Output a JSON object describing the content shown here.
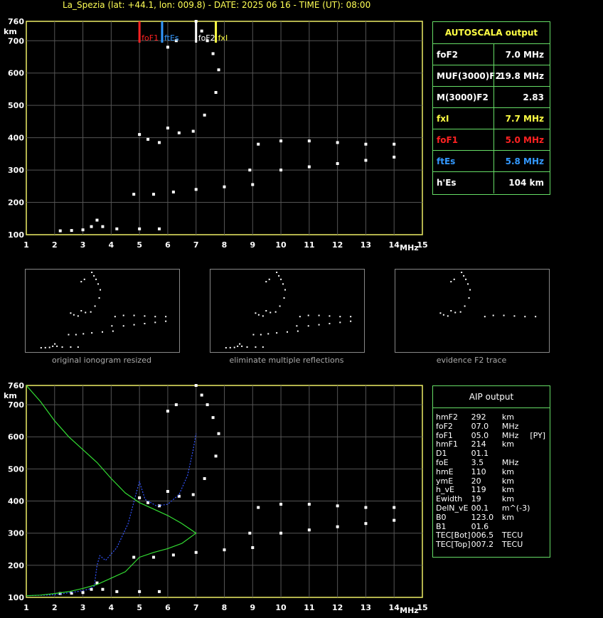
{
  "title": "La_Spezia (lat: +44.1, lon: 009.8) - DATE: 2025 06 16 - TIME (UT): 08:00",
  "autoscala": {
    "title": "AUTOSCALA output",
    "rows": [
      {
        "label": "foF2",
        "value": "7.0 MHz",
        "color": "#ffffff"
      },
      {
        "label": "MUF(3000)F2",
        "value": "19.8 MHz",
        "color": "#ffffff"
      },
      {
        "label": "M(3000)F2",
        "value": "2.83",
        "color": "#ffffff"
      },
      {
        "label": "fxI",
        "value": "7.7 MHz",
        "color": "#ffff44"
      },
      {
        "label": "foF1",
        "value": "5.0 MHz",
        "color": "#ff2222"
      },
      {
        "label": "ftEs",
        "value": "5.8 MHz",
        "color": "#3399ff"
      },
      {
        "label": "h'Es",
        "value": "104     km",
        "color": "#ffffff"
      }
    ]
  },
  "aip": {
    "title": "AIP output",
    "rows": [
      [
        "hmF2",
        "292",
        "km",
        ""
      ],
      [
        "foF2",
        "07.0",
        "MHz",
        ""
      ],
      [
        "foF1",
        "05.0",
        "MHz",
        "[PY]"
      ],
      [
        "hmF1",
        "214",
        "km",
        ""
      ],
      [
        "D1",
        "01.1",
        "",
        ""
      ],
      [
        "foE",
        "3.5",
        "MHz",
        ""
      ],
      [
        "hmE",
        "110",
        "km",
        ""
      ],
      [
        "ymE",
        "20",
        "km",
        ""
      ],
      [
        "h_vE",
        "119",
        "km",
        ""
      ],
      [
        "Ewidth",
        "19",
        "km",
        ""
      ],
      [
        "DelN_vE",
        "00.1",
        "m^(-3)",
        ""
      ],
      [
        "B0",
        "123.0",
        "km",
        ""
      ],
      [
        "B1",
        "01.6",
        "",
        ""
      ],
      [
        "TEC[Bot]",
        "006.5",
        "TECU",
        ""
      ],
      [
        "TEC[Top]",
        "007.2",
        "TECU",
        ""
      ]
    ]
  },
  "thumbnails": [
    {
      "caption": "original ionogram resized"
    },
    {
      "caption": "eliminate multiple reflections"
    },
    {
      "caption": "evidence F2 trace"
    }
  ],
  "markers": [
    {
      "label": "foF1",
      "freq": 5.0,
      "color": "#ff2222"
    },
    {
      "label": "ftEs",
      "freq": 5.8,
      "color": "#3399ff"
    },
    {
      "label": "foF2",
      "freq": 7.0,
      "color": "#ffffff"
    },
    {
      "label": "fxI",
      "freq": 7.7,
      "color": "#ffff44"
    }
  ],
  "axis": {
    "x_unit": "MHz",
    "y_unit": "km",
    "x_ticks": [
      "1",
      "2",
      "3",
      "4",
      "5",
      "6",
      "7",
      "8",
      "9",
      "10",
      "11",
      "12",
      "13",
      "14",
      "15"
    ],
    "y_ticks": [
      "100",
      "200",
      "300",
      "400",
      "500",
      "600",
      "700",
      "760"
    ]
  },
  "chart_data": [
    {
      "type": "scatter",
      "title": "",
      "xlabel": "MHz",
      "ylabel": "km",
      "xlim": [
        1,
        15
      ],
      "ylim": [
        100,
        760
      ],
      "grid": true,
      "series": [
        {
          "name": "",
          "color": "#ffffff",
          "x": [
            2.2,
            2.6,
            3.0,
            3.3,
            3.5,
            3.7,
            4.2,
            5.0,
            5.7,
            5.0,
            5.3,
            5.7,
            6.0,
            6.4,
            6.9,
            7.3,
            7.7,
            7.8,
            7.6,
            7.4,
            7.2,
            7.0,
            4.8,
            5.5,
            6.2,
            7.0,
            8.0,
            9.0,
            8.9,
            10.0,
            11.0,
            12.0,
            13.0,
            14.0,
            9.2,
            10.0,
            11.0,
            12.0,
            13.0,
            14.0,
            6.0,
            6.3
          ],
          "y": [
            112,
            113,
            115,
            125,
            145,
            125,
            118,
            118,
            118,
            410,
            395,
            385,
            430,
            415,
            420,
            470,
            540,
            610,
            660,
            700,
            730,
            760,
            225,
            225,
            232,
            240,
            248,
            255,
            300,
            300,
            310,
            320,
            330,
            340,
            380,
            390,
            390,
            385,
            380,
            380,
            680,
            700
          ]
        },
        {
          "name": "",
          "color": "#3355ff",
          "x": [
            1.0,
            2.0,
            2.8,
            3.2,
            3.4,
            3.5,
            3.6,
            3.8,
            4.2,
            4.6,
            4.9,
            5.0,
            5.2,
            5.6,
            6.0,
            6.4,
            6.7,
            6.9,
            7.0
          ],
          "y": [
            105,
            108,
            118,
            125,
            135,
            200,
            230,
            215,
            255,
            330,
            430,
            460,
            405,
            385,
            390,
            420,
            480,
            560,
            610
          ]
        },
        {
          "name": "",
          "color": "#33dd33",
          "x": [
            1.0,
            1.5,
            2.0,
            2.5,
            3.0,
            3.5,
            4.0,
            4.5,
            5.0,
            5.5,
            6.0,
            6.5,
            7.0,
            6.5,
            6.0,
            5.5,
            5.0,
            4.5,
            4.0,
            3.5,
            3.0,
            2.5,
            2.0,
            1.5,
            1.0
          ],
          "y": [
            105,
            107,
            112,
            118,
            128,
            140,
            160,
            180,
            225,
            240,
            252,
            268,
            300,
            330,
            355,
            375,
            395,
            425,
            470,
            520,
            560,
            600,
            650,
            710,
            760
          ]
        }
      ]
    }
  ]
}
